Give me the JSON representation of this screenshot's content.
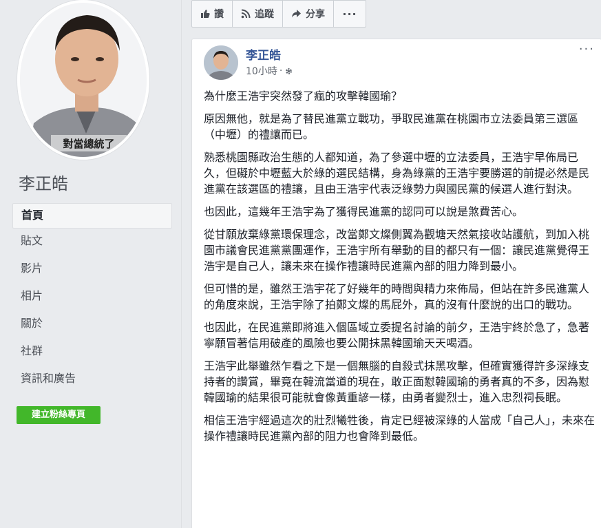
{
  "sidebar": {
    "page_name": "李正皓",
    "photo_caption": "對當總統了",
    "nav": [
      {
        "label": "首頁"
      },
      {
        "label": "貼文"
      },
      {
        "label": "影片"
      },
      {
        "label": "相片"
      },
      {
        "label": "關於"
      },
      {
        "label": "社群"
      },
      {
        "label": "資訊和廣告"
      }
    ],
    "create_page_label": "建立粉絲專頁"
  },
  "action_bar": {
    "like_label": "讚",
    "follow_label": "追蹤",
    "share_label": "分享",
    "more_label": "···"
  },
  "post": {
    "author": "李正皓",
    "time": "10小時",
    "dot": "·",
    "options_label": "···",
    "paragraphs": [
      "為什麼王浩宇突然發了瘋的攻擊韓國瑜？",
      "原因無他，就是為了替民進黨立戰功，爭取民進黨在桃園市立法委員第三選區（中壢）的禮讓而已。",
      "熟悉桃園縣政治生態的人都知道，為了參選中壢的立法委員，王浩宇早佈局已久，但礙於中壢藍大於綠的選民結構，身為綠黨的王浩宇要勝選的前提必然是民進黨在該選區的禮讓，且由王浩宇代表泛綠勢力與國民黨的候選人進行對決。",
      "也因此，這幾年王浩宇為了獲得民進黨的認同可以說是煞費苦心。",
      "從甘願放棄綠黨環保理念，改當鄭文燦側翼為觀塘天然氣接收站護航，到加入桃園市議會民進黨黨團運作，王浩宇所有舉動的目的都只有一個：讓民進黨覺得王浩宇是自己人，讓未來在操作禮讓時民進黨內部的阻力降到最小。",
      "但可惜的是，雖然王浩宇花了好幾年的時間與精力來佈局，但站在許多民進黨人的角度來說，王浩宇除了拍鄭文燦的馬屁外，真的沒有什麼說的出口的戰功。",
      "也因此，在民進黨即將進入個區域立委提名討論的前夕，王浩宇終於急了，急著寧願冒著信用破產的風險也要公開抹黑韓國瑜天天喝酒。",
      "王浩宇此舉雖然乍看之下是一個無腦的自殺式抹黑攻擊，但確實獲得許多深綠支持者的讚賞，畢竟在韓流當道的現在，敢正面懟韓國瑜的勇者真的不多，因為懟韓國瑜的結果很可能就會像黃重諺一樣，由勇者變烈士，進入忠烈祠長眠。",
      "相信王浩宇經過這次的壯烈犧牲後，肯定已經被深綠的人當成「自己人」，未來在操作禮讓時民進黨內部的阻力也會降到最低。"
    ]
  },
  "colors": {
    "link_blue": "#385898",
    "green_button": "#42b72a",
    "background": "#e9ebee"
  },
  "icons": [
    "thumbs-up-icon",
    "rss-follow-icon",
    "share-arrow-icon",
    "more-dots-icon",
    "globe-gear-icon"
  ]
}
